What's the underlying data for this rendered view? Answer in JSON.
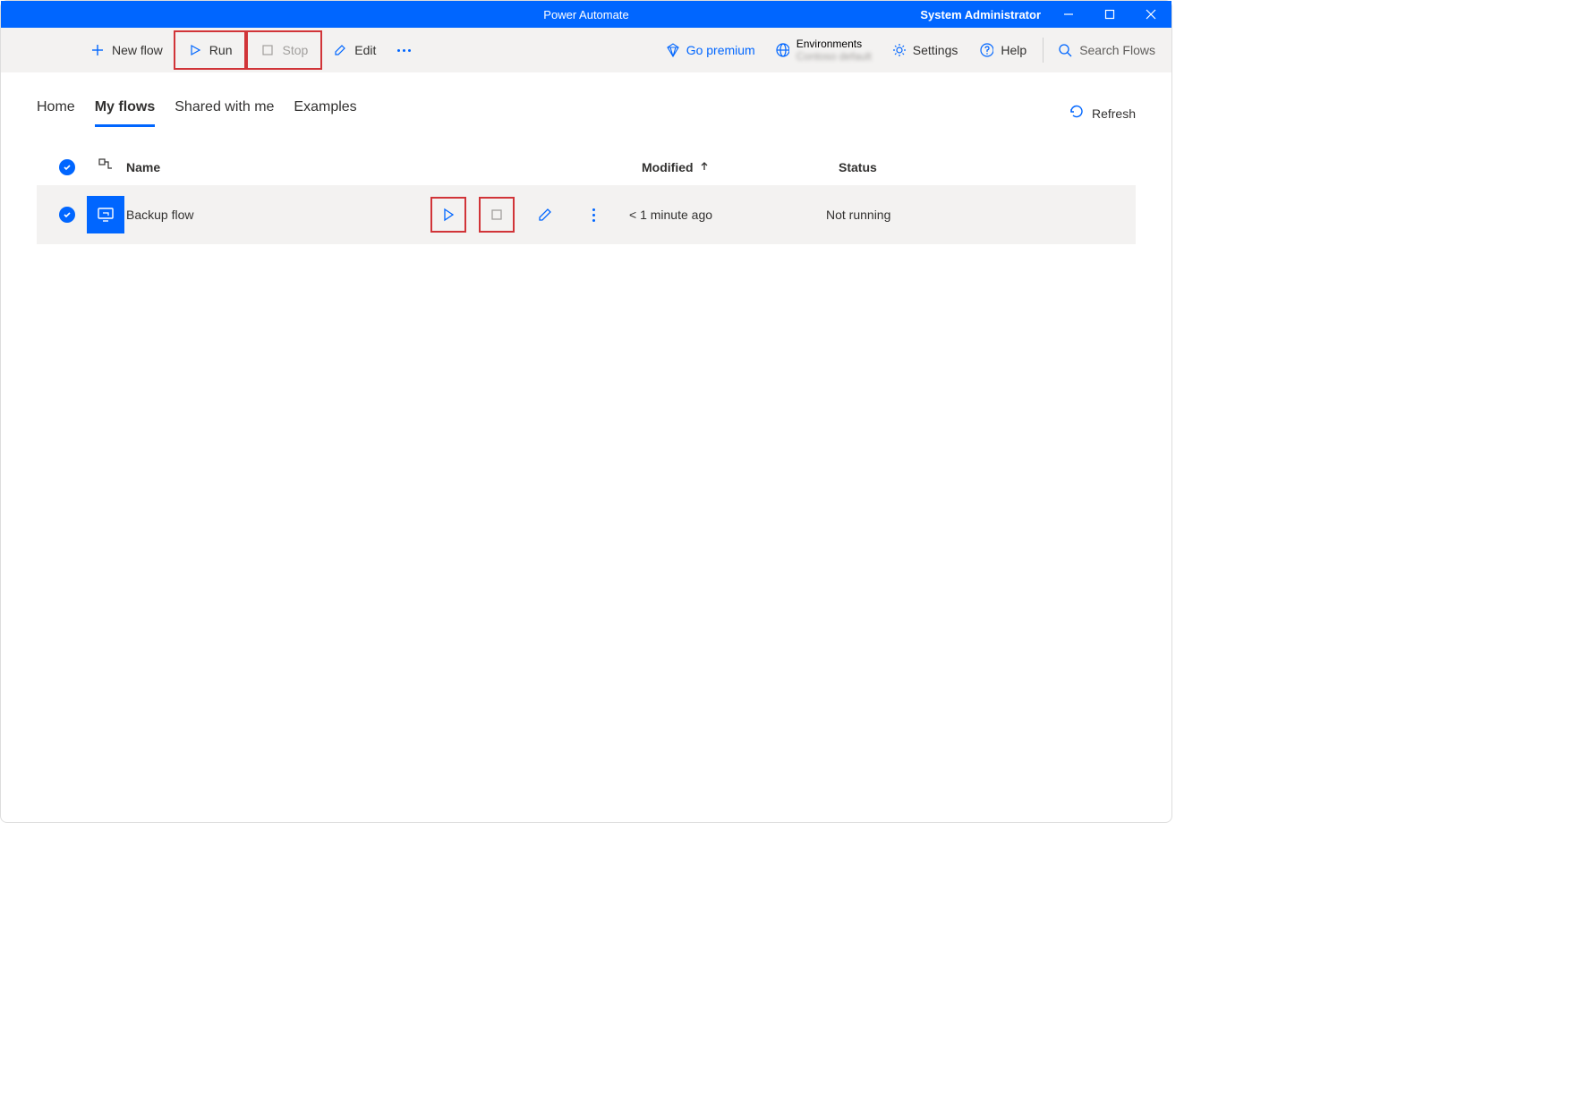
{
  "titlebar": {
    "title": "Power Automate",
    "user": "System Administrator"
  },
  "toolbar": {
    "new_flow": "New flow",
    "run": "Run",
    "stop": "Stop",
    "edit": "Edit",
    "go_premium": "Go premium",
    "environments_label": "Environments",
    "settings": "Settings",
    "help": "Help",
    "search_placeholder": "Search Flows"
  },
  "tabs": {
    "home": "Home",
    "my_flows": "My flows",
    "shared": "Shared with me",
    "examples": "Examples"
  },
  "refresh": "Refresh",
  "columns": {
    "name": "Name",
    "modified": "Modified",
    "status": "Status"
  },
  "rows": [
    {
      "name": "Backup flow",
      "modified": "< 1 minute ago",
      "status": "Not running"
    }
  ]
}
